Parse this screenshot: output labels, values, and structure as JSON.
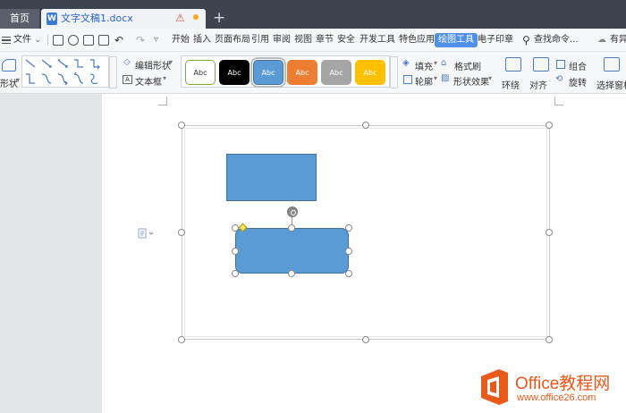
{
  "tabs": {
    "home_label": "首页",
    "doc_icon": "W",
    "doc_title": "文字文稿1.docx"
  },
  "menubar": {
    "file_label": "文件",
    "items": [
      "开始",
      "插入",
      "页面布局",
      "引用",
      "审阅",
      "视图",
      "章节",
      "安全",
      "开发工具",
      "特色应用",
      "绘图工具",
      "电子印章"
    ],
    "active_item": "绘图工具",
    "search_label": "查找命令...",
    "right_label": "有异"
  },
  "ribbon": {
    "shape_label": "形状",
    "edit_shape_label": "编辑形状",
    "textbox_label": "文本框",
    "style_swatches": [
      {
        "label": "Abc",
        "bg": "#ffffff",
        "fg": "#333333",
        "border": "#70ad47"
      },
      {
        "label": "Abc",
        "bg": "#000000",
        "fg": "#ffffff",
        "border": "#000000"
      },
      {
        "label": "Abc",
        "bg": "#5b9bd5",
        "fg": "#ffffff",
        "border": "#41719c"
      },
      {
        "label": "Abc",
        "bg": "#ed7d31",
        "fg": "#ffffff",
        "border": "#ed7d31"
      },
      {
        "label": "Abc",
        "bg": "#a5a5a5",
        "fg": "#ffffff",
        "border": "#a5a5a5"
      },
      {
        "label": "Abc",
        "bg": "#ffc000",
        "fg": "#ffffff",
        "border": "#ffc000"
      }
    ],
    "fill_label": "填充",
    "format_painter_label": "格式刷",
    "outline_label": "轮廓",
    "shape_effect_label": "形状效果",
    "wrap_label": "环绕",
    "align_label": "对齐",
    "group_label": "组合",
    "rotate_label": "旋转",
    "selection_pane_label": "选择窗格"
  },
  "watermark": {
    "brand": "Office教程网",
    "url": "www.office26.com"
  },
  "colors": {
    "shape_fill": "#5b9bd5",
    "shape_border": "#41719c",
    "active_tab": "#4f8fe6",
    "tab_bar": "#3d434f",
    "watermark_orange": "#e8591a"
  }
}
